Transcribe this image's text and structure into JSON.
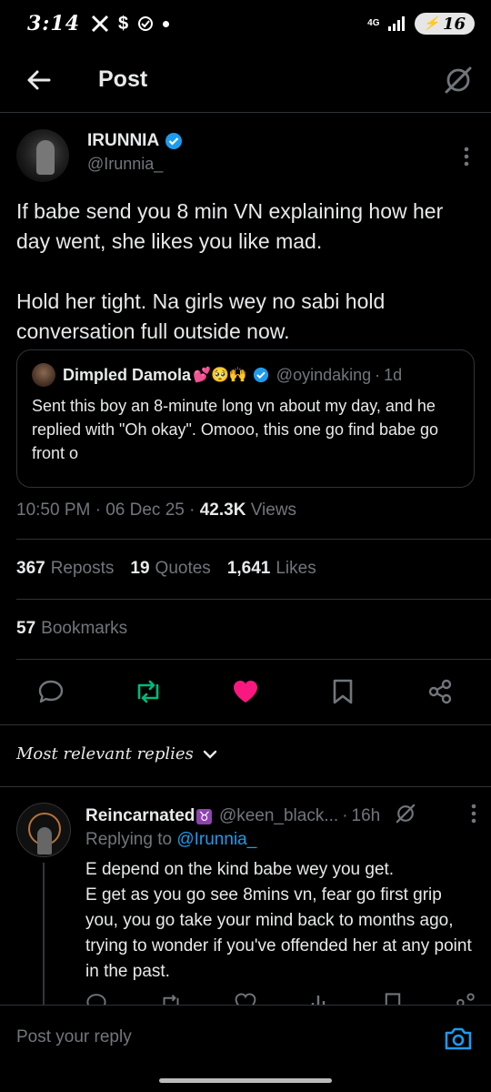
{
  "status_bar": {
    "time": "3:14",
    "icons": [
      "x-icon",
      "s-icon",
      "check-circle-icon",
      "dot-icon"
    ],
    "network": "4G",
    "battery": "16"
  },
  "header": {
    "title": "Post",
    "back_icon": "arrow-left-icon",
    "grok_icon": "grok-icon"
  },
  "post": {
    "author": {
      "name": "IRUNNIA",
      "handle": "@Irunnia_",
      "verified": true
    },
    "text": [
      "If babe send you 8 min VN explaining how her day went, she likes you like mad.",
      "Hold her tight. Na girls wey no sabi hold conversation full outside now."
    ],
    "quote": {
      "name": "Dimpled Damola",
      "emojis": "💕🥺🙌",
      "handle": "@oyindaking",
      "time": "1d",
      "text": "Sent this boy an 8-minute long vn about my day, and he replied with \"Oh okay\". Omooo, this one go find babe go front o"
    },
    "time": "10:50 PM",
    "date": "06 Dec 25",
    "views_count": "42.3K",
    "views_label": "Views",
    "reposts_count": "367",
    "reposts_label": "Reposts",
    "quotes_count": "19",
    "quotes_label": "Quotes",
    "likes_count": "1,641",
    "likes_label": "Likes",
    "bookmarks_count": "57",
    "bookmarks_label": "Bookmarks"
  },
  "replies_sort": {
    "label": "Most relevant replies"
  },
  "reply": {
    "name": "Reincarnated",
    "emoji": "♉",
    "handle": "@keen_black...",
    "time": "16h",
    "replying_prefix": "Replying to",
    "replying_to": "@Irunnia_",
    "text": "E depend on the kind babe wey you get.\nE get as you go see 8mins vn, fear go first grip you, you go take your mind back to months ago, trying to wonder if you've offended her at any point in the past."
  },
  "composer": {
    "placeholder": "Post your reply"
  },
  "colors": {
    "background": "#000000",
    "text": "#e7e9ea",
    "muted": "#71767b",
    "accent": "#1d9bf0",
    "repost": "#00ba7c",
    "like": "#f91880"
  }
}
